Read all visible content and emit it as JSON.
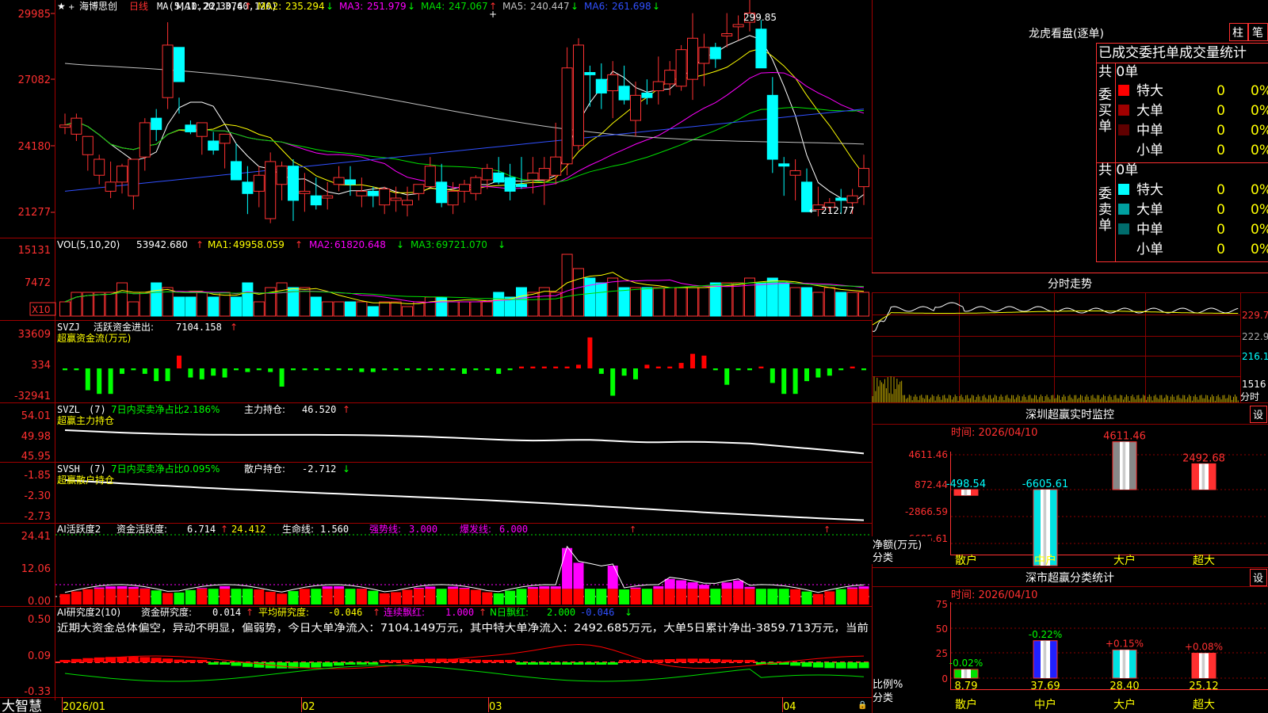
{
  "k_panel": {
    "star": "★",
    "stock_name": "海博思创",
    "period": "日线",
    "ma_params": "MA(5,10,20,30,60,120)",
    "ma": [
      {
        "label": "MA1:",
        "value": "221.374",
        "arrow": "↑",
        "color": "#ffffff"
      },
      {
        "label": "MA2:",
        "value": "235.294",
        "arrow": "↓",
        "color": "#ffff00"
      },
      {
        "label": "MA3:",
        "value": "251.979",
        "arrow": "↓",
        "color": "#ff00ff"
      },
      {
        "label": "MA4:",
        "value": "247.067",
        "arrow": "↑",
        "color": "#00e000"
      },
      {
        "label": "MA5:",
        "value": "240.447",
        "arrow": "↓",
        "color": "#c0c0c0"
      },
      {
        "label": "MA6:",
        "value": "261.698",
        "arrow": "↓",
        "color": "#3050ff"
      }
    ],
    "y_ticks": [
      "29985",
      "27082",
      "24180",
      "21277"
    ],
    "high_label": "299.85",
    "low_label": "212.77",
    "arrow_left": "←",
    "candles": [
      [
        250,
        256,
        247,
        251
      ],
      [
        247,
        256,
        244,
        254
      ],
      [
        238,
        246,
        231,
        246
      ],
      [
        229,
        238,
        225,
        236
      ],
      [
        222,
        235,
        219,
        226
      ],
      [
        226,
        234,
        221,
        233
      ],
      [
        220,
        235,
        214,
        236
      ],
      [
        237,
        254,
        231,
        252
      ],
      [
        254,
        258,
        244,
        249
      ],
      [
        263,
        296,
        258,
        286
      ],
      [
        285,
        263,
        256,
        270
      ],
      [
        251,
        253,
        247,
        248
      ],
      [
        246,
        252,
        238,
        252
      ],
      [
        244,
        248,
        238,
        240
      ],
      [
        243,
        247,
        232,
        247
      ],
      [
        235,
        243,
        228,
        227
      ],
      [
        226,
        233,
        212,
        221
      ],
      [
        222,
        233,
        215,
        229
      ],
      [
        210,
        239,
        208,
        235
      ],
      [
        225,
        235,
        218,
        233
      ],
      [
        233,
        236,
        209,
        218
      ],
      [
        221,
        230,
        213,
        222
      ],
      [
        220,
        228,
        214,
        216
      ],
      [
        219,
        226,
        214,
        220
      ],
      [
        225,
        233,
        222,
        228
      ],
      [
        227,
        233,
        220,
        225
      ],
      [
        220,
        228,
        215,
        222
      ],
      [
        222,
        224,
        215,
        220
      ],
      [
        216,
        224,
        212,
        223
      ],
      [
        218,
        224,
        213,
        219
      ],
      [
        216,
        224,
        211,
        218
      ],
      [
        221,
        224,
        218,
        225
      ],
      [
        224,
        237,
        224,
        233
      ],
      [
        226,
        234,
        215,
        217
      ],
      [
        216,
        226,
        212,
        222
      ],
      [
        222,
        227,
        217,
        225
      ],
      [
        221,
        229,
        218,
        228
      ],
      [
        227,
        234,
        223,
        232
      ],
      [
        230,
        237,
        225,
        226
      ],
      [
        228,
        234,
        218,
        222
      ],
      [
        225,
        237,
        223,
        224
      ],
      [
        227,
        237,
        221,
        230
      ],
      [
        227,
        237,
        216,
        232
      ],
      [
        229,
        252,
        225,
        237
      ],
      [
        234,
        285,
        229,
        276
      ],
      [
        242,
        289,
        240,
        286
      ],
      [
        274,
        277,
        259,
        273
      ],
      [
        271,
        278,
        258,
        265
      ],
      [
        266,
        279,
        254,
        273
      ],
      [
        268,
        277,
        260,
        262
      ],
      [
        253,
        270,
        246,
        264
      ],
      [
        265,
        271,
        260,
        263
      ],
      [
        266,
        281,
        260,
        270
      ],
      [
        269,
        279,
        264,
        275
      ],
      [
        268,
        286,
        266,
        284
      ],
      [
        271,
        300,
        262,
        289
      ],
      [
        278,
        291,
        268,
        285
      ],
      [
        285,
        287,
        276,
        280
      ],
      [
        290,
        300,
        285,
        291
      ],
      [
        294,
        299,
        288,
        295
      ],
      [
        296,
        310,
        292,
        300
      ],
      [
        293,
        297,
        286,
        276
      ],
      [
        264,
        272,
        230,
        236
      ],
      [
        234,
        237,
        220,
        233
      ],
      [
        229,
        236,
        218,
        231
      ],
      [
        226,
        232,
        216,
        213
      ],
      [
        214,
        224,
        211,
        216
      ],
      [
        215,
        219,
        213,
        217
      ],
      [
        219,
        223,
        212,
        218
      ],
      [
        217,
        223,
        212,
        220
      ],
      [
        224,
        238,
        216,
        232
      ]
    ]
  },
  "vol_panel": {
    "title": "VOL(5,10,20)",
    "value": "53942.680",
    "ma": [
      {
        "label": "MA1:",
        "value": "49958.059",
        "arrow": "↑",
        "color": "#ffff00"
      },
      {
        "label": "MA2:",
        "value": "61820.648",
        "arrow": "↓",
        "color": "#ff00ff"
      },
      {
        "label": "MA3:",
        "value": "69721.070",
        "arrow": "↓",
        "color": "#00e000"
      }
    ],
    "y_ticks": [
      "15131",
      "7472"
    ],
    "unit": "X10",
    "volumes": [
      3,
      5,
      5,
      5,
      5,
      7,
      3,
      5,
      7,
      6,
      4,
      4,
      5,
      4,
      5,
      4,
      7,
      3,
      6,
      7,
      6,
      6,
      4,
      3,
      3,
      3,
      3,
      2,
      3,
      3,
      2,
      3,
      4,
      4,
      3,
      3,
      3,
      3,
      5,
      4,
      6,
      5,
      6,
      5,
      13,
      10,
      8,
      7,
      8,
      6,
      6,
      6,
      6,
      6,
      6,
      6,
      6,
      7,
      7,
      7,
      8,
      7,
      8,
      7,
      6,
      6,
      5,
      6,
      5,
      5,
      5
    ]
  },
  "svzj_panel": {
    "title": "SVZJ",
    "label": "活跃资金进出:",
    "value": "7104.158",
    "arrow": "↑",
    "sub": "超赢资金流(万元)",
    "y_ticks": [
      "33609",
      "334",
      "-32941"
    ],
    "values": [
      -1,
      -1,
      -12,
      -14,
      -14,
      -3,
      -1,
      -3,
      -7,
      -7,
      7,
      -5,
      -6,
      -4,
      -5,
      -1,
      -2,
      -1,
      -2,
      -10,
      -1,
      -1,
      -1,
      -1,
      -1,
      -1,
      -2,
      -2,
      -1,
      -1,
      -1,
      -1,
      -1,
      -1,
      -1,
      -3,
      -1,
      -1,
      -3,
      -1,
      1,
      1,
      1,
      1,
      1,
      2,
      17,
      -3,
      -15,
      -4,
      -6,
      2,
      1,
      1,
      3,
      8,
      7,
      -1,
      -9,
      -1,
      -1,
      1,
      -8,
      -14,
      -14,
      -7,
      -5,
      -4,
      -1,
      1,
      -1,
      3
    ]
  },
  "svzl_panel": {
    "title": "SVZL",
    "param": "(7)",
    "ratio_label": "7日内买卖净占比2.186%",
    "label": "主力持仓:",
    "value": "46.520",
    "arrow": "↑",
    "sub": "超赢主力持仓",
    "y_ticks": [
      "54.01",
      "49.98",
      "45.95"
    ]
  },
  "svsh_panel": {
    "title": "SVSH",
    "param": "(7)",
    "ratio_label": "7日内买卖净占比0.095%",
    "label": "散户持仓:",
    "value": "-2.712",
    "arrow": "↓",
    "sub": "超赢散户持仓",
    "y_ticks": [
      "-1.85",
      "-2.30",
      "-2.73"
    ]
  },
  "ai_active_panel": {
    "title": "AI活跃度2",
    "label": "资金活跃度:",
    "value": "6.714",
    "arrow1": "↑",
    "value2": "24.412",
    "life_label": "生命线:",
    "life_value": "1.560",
    "strong_label": "强势线:",
    "strong_value": "3.000",
    "burst_label": "爆发线:",
    "burst_value": "6.000",
    "y_ticks": [
      "24.41",
      "12.06",
      "0.00"
    ]
  },
  "ai_research_panel": {
    "title": "AI研究度2(10)",
    "label": "资金研究度:",
    "value": "0.014",
    "avg_label": "平均研究度:",
    "avg_value": "-0.046",
    "red_label": "连续飘红:",
    "red_value": "1.000",
    "nred_label": "N日飘红:",
    "nred_value": "2.000",
    "last_value": "-0.046",
    "commentary": "近期大资金总体偏空，异动不明显，偏弱势，今日大单净流入：7104.149万元，其中特大单净流入：2492.685万元，大单5日累计净出-3859.713万元，当前",
    "y_ticks": [
      "0.50",
      "0.09",
      "-0.33"
    ]
  },
  "x_axis": {
    "logo": "大智慧",
    "labels": [
      "2026/01",
      "02",
      "03",
      "04"
    ]
  },
  "dragon_tiger": {
    "title": "龙虎看盘(逐单)",
    "btn_bar": "柱",
    "btn_stroke": "笔",
    "header": "已成交委托单成交量统计",
    "buy_side": "委买单",
    "sell_side": "委卖单",
    "buy_total": "共 0单",
    "sell_total": "共 0单",
    "buy_rows": [
      {
        "label": "特大",
        "count": "0",
        "pct": "0%",
        "color": "#ff0000"
      },
      {
        "label": "大单",
        "count": "0",
        "pct": "0%",
        "color": "#a00000"
      },
      {
        "label": "中单",
        "count": "0",
        "pct": "0%",
        "color": "#600000"
      },
      {
        "label": "小单",
        "count": "0",
        "pct": "0%",
        "color": "#000000"
      }
    ],
    "sell_rows": [
      {
        "label": "特大",
        "count": "0",
        "pct": "0%",
        "color": "#00ffff"
      },
      {
        "label": "大单",
        "count": "0",
        "pct": "0%",
        "color": "#00a0a0"
      },
      {
        "label": "中单",
        "count": "0",
        "pct": "0%",
        "color": "#006c6c"
      },
      {
        "label": "小单",
        "count": "0",
        "pct": "0%",
        "color": "#000000"
      }
    ]
  },
  "intraday": {
    "title": "分时走势",
    "y_ticks": [
      "229.7",
      "222.9",
      "216.1"
    ],
    "vol_tick": "1516",
    "vol_unit": "分时"
  },
  "sz_monitor": {
    "title": "深圳超赢实时监控",
    "set_btn": "设",
    "time": "时间: 2026/04/10",
    "y_ticks": [
      "4611.46",
      "872.44",
      "-2866.59",
      "-6605.61"
    ],
    "y_unit": "净额(万元)",
    "x_unit": "分类",
    "categories": [
      "散户",
      "中户",
      "大户",
      "超大"
    ],
    "values": [
      -498.54,
      -6605.61,
      4611.46,
      2492.68
    ],
    "value_labels": [
      "-498.54",
      "-6605.61",
      "4611.46",
      "2492.68"
    ]
  },
  "sz_class": {
    "title": "深市超赢分类统计",
    "set_btn": "设",
    "time": "时间: 2026/04/10",
    "y_ticks": [
      "75",
      "50",
      "25",
      "0"
    ],
    "y_unit": "比例%",
    "x_unit": "分类",
    "categories": [
      "散户",
      "中户",
      "大户",
      "超大"
    ],
    "values": [
      8.79,
      37.69,
      28.4,
      25.12
    ],
    "value_labels": [
      "8.79",
      "37.69",
      "28.40",
      "25.12"
    ],
    "changes": [
      "-0.02%",
      "-0.22%",
      "+0.15%",
      "+0.08%"
    ],
    "change_colors": [
      "#00ff00",
      "#00ff00",
      "#ff3030",
      "#ff3030"
    ]
  },
  "colors": {
    "up": "#ff3232",
    "down": "#00ffff",
    "grid": "#8b0000",
    "axis": "#b00000"
  }
}
